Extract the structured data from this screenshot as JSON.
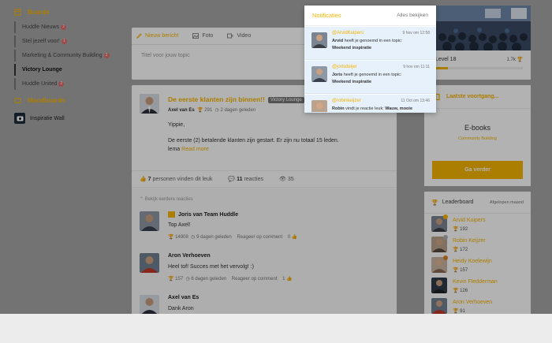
{
  "colors": {
    "accent": "#f5b400",
    "badge": "#e26a6a"
  },
  "sidebar": {
    "boards_title": "Boards",
    "boards": [
      {
        "label": "Huddle Nieuws",
        "badge": "2"
      },
      {
        "label": "Stel jezelf voor!",
        "badge": "1"
      },
      {
        "label": "Marketing & Community Building",
        "badge": "2"
      },
      {
        "label": "Victory Lounge",
        "active": true
      },
      {
        "label": "Huddle United",
        "badge": "2"
      }
    ],
    "moodboards_title": "Moodboards",
    "moodboard_item": "Inspiratie Wall"
  },
  "composer": {
    "tabs": [
      {
        "label": "Nieuw bericht",
        "icon": "pencil-icon"
      },
      {
        "label": "Foto",
        "icon": "image-icon"
      },
      {
        "label": "Video",
        "icon": "video-icon"
      }
    ],
    "placeholder": "Titel voor jouw topic"
  },
  "post": {
    "title": "De eerste klanten zijn binnen!!",
    "board_tag": "Victory Lounge",
    "author": "Axel van Es",
    "points": "291",
    "time": "2 dagen geleden",
    "body_line1": "Yippie,",
    "body_line2": "De eerste (2) betalende klanten zijn gestart. Er zijn nu totaal 15 leden.",
    "body_line3": "lema",
    "read_more": "Read more",
    "likes_count": "7",
    "likes_text": "personen vinden dit leuk",
    "reactions_count": "11",
    "reactions_text": "reacties",
    "views": "35"
  },
  "comments": {
    "show_earlier": "Bekijk eerdere reacties",
    "items": [
      {
        "name": "Joris van Team Huddle",
        "text": "Top Axel!",
        "points": "14908",
        "time": "9 dagen geleden",
        "reply": "Reageer op comment",
        "likes": "0"
      },
      {
        "name": "Aron Verhoeven",
        "text": "Heel tof! Succes met het vervolg! :)",
        "points": "157",
        "time": "6 dagen geleden",
        "reply": "Reageer op comment",
        "likes": "1"
      },
      {
        "name": "Axel van Es",
        "text": "Dank Aron"
      }
    ]
  },
  "notifications": {
    "title": "Notificaties",
    "view_all": "Alles bekijken",
    "items": [
      {
        "who": "@ArvidKuipers",
        "time": "9 hov om 12:58",
        "line1_name": "Arvid",
        "line1": "heeft je genoemd in een topic:",
        "line2": "Weekend inspiratie"
      },
      {
        "who": "@jorisdeijer",
        "time": "9 hov om 11:11",
        "line1_name": "Joris",
        "line1": "heeft je genoemd in een topic:",
        "line2": "Weekend inspiratie"
      },
      {
        "who": "@robinkeijzer",
        "time": "11 Oct om 13:46",
        "line1_name": "Robin",
        "line1": "vindt je reactie leuk:",
        "line2": "Wauw, mooie"
      }
    ]
  },
  "level": {
    "label": "Level 18",
    "points": "1.7k",
    "progress": 0.17
  },
  "ebook": {
    "header": "Laatste voortgang...",
    "title": "E-books",
    "subtitle": "Community Building",
    "button": "Ga verder"
  },
  "leaderboard": {
    "title": "Leaderboard",
    "period": "Afgelopen maand",
    "items": [
      {
        "name": "Arvid Kuipers",
        "points": "192",
        "rank_color": "#f5b400"
      },
      {
        "name": "Robin Keijzer",
        "points": "172",
        "rank_color": "#b0b0b0"
      },
      {
        "name": "Heidy Koelewijn",
        "points": "157",
        "rank_color": "#d8822b"
      },
      {
        "name": "Kevin Fledderman",
        "points": "126"
      },
      {
        "name": "Aron Verhoeven",
        "points": "91"
      }
    ]
  }
}
